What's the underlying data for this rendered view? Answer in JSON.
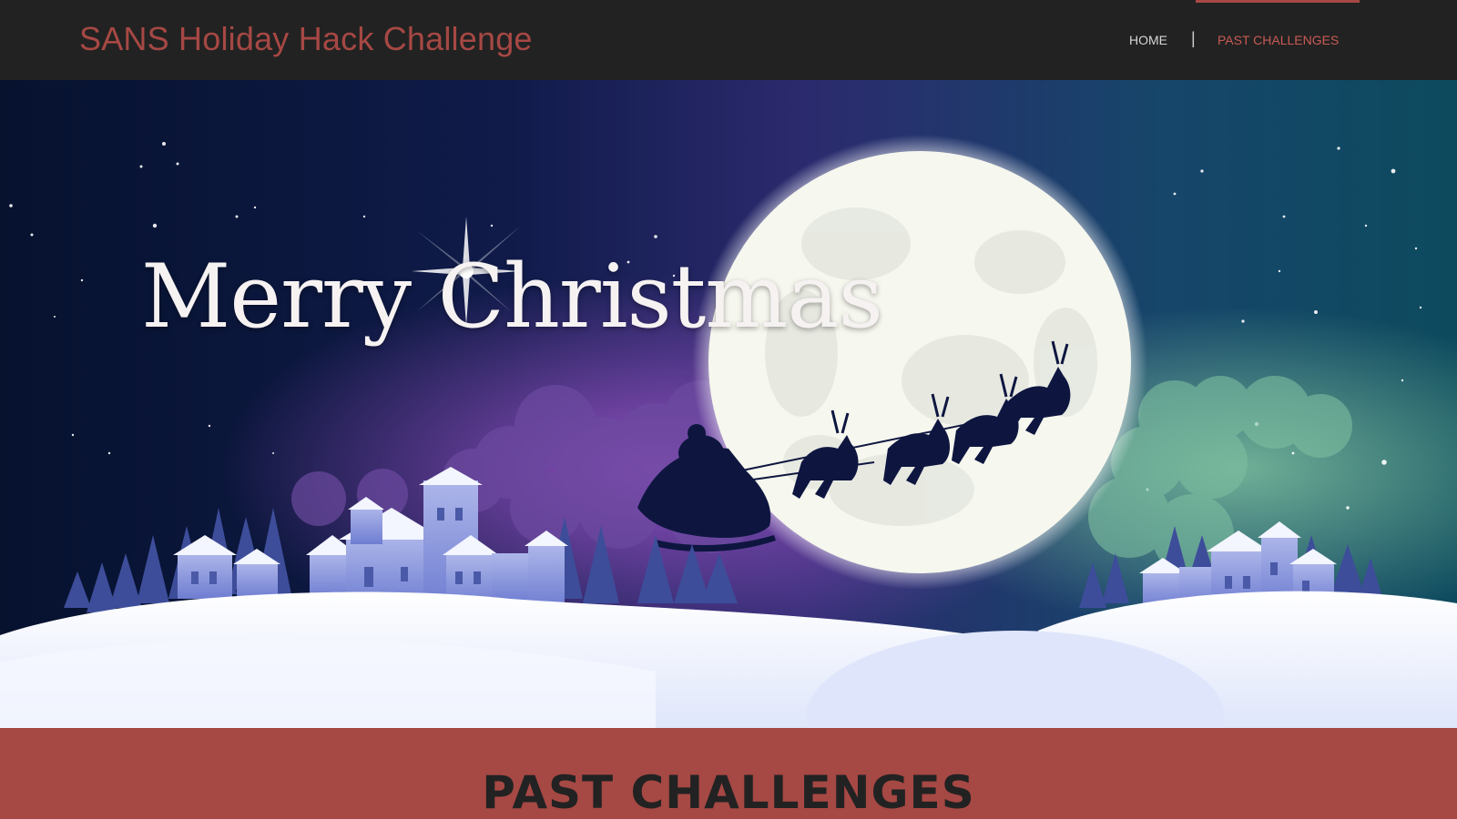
{
  "header": {
    "site_title": "SANS Holiday Hack Challenge",
    "nav": [
      {
        "label": "HOME"
      },
      {
        "label": "|"
      },
      {
        "label": "PAST CHALLENGES"
      }
    ]
  },
  "hero": {
    "greeting": "Merry Christmas"
  },
  "section": {
    "title": "PAST CHALLENGES"
  },
  "colors": {
    "brand": "#a64844",
    "topbar": "#222222",
    "nav_active": "#c95a55"
  }
}
